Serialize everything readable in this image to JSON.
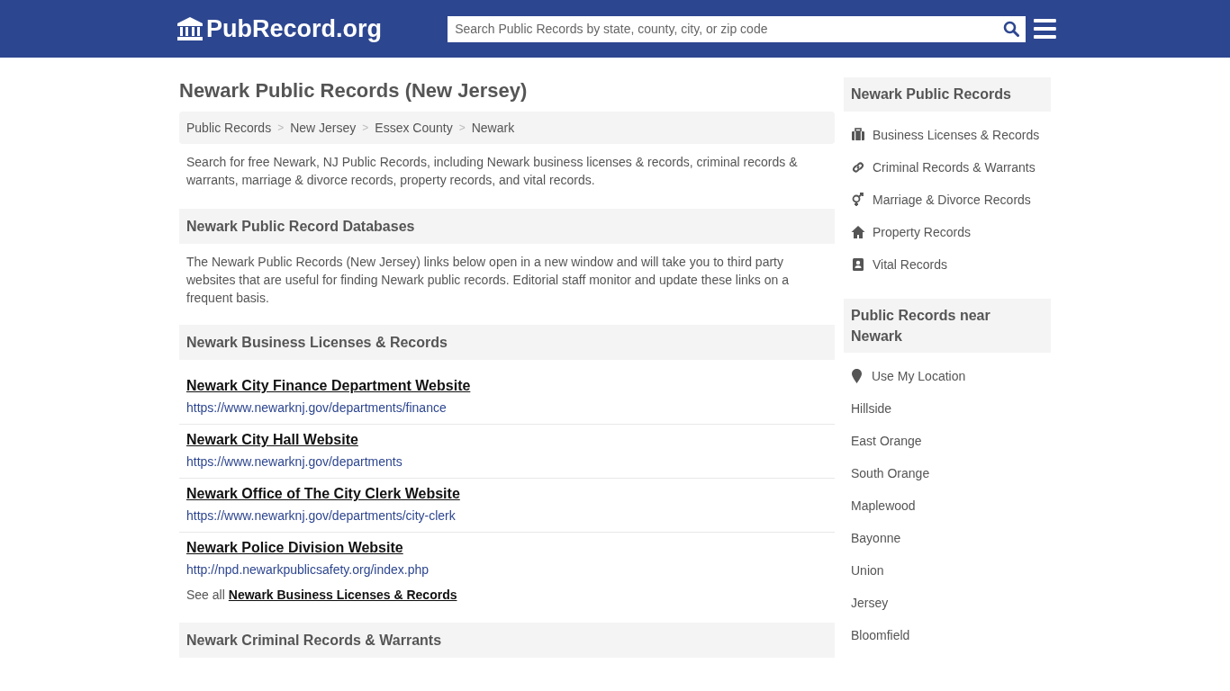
{
  "header": {
    "logo": "PubRecord.org",
    "search": {
      "placeholder": "Search Public Records by state, county, city, or zip code"
    }
  },
  "page_title": "Newark Public Records (New Jersey)",
  "breadcrumb": [
    {
      "label": "Public Records",
      "separator": ">"
    },
    {
      "label": "New Jersey",
      "separator": ">"
    },
    {
      "label": "Essex County",
      "separator": ">"
    },
    {
      "label": "Newark"
    }
  ],
  "intro": "Search for free Newark, NJ Public Records, including Newark business licenses & records, criminal records & warrants, marriage & divorce records, property records, and vital records.",
  "databases": {
    "heading": "Newark Public Record Databases",
    "text": "The Newark Public Records (New Jersey) links below open in a new window and will take you to third party websites that are useful for finding Newark public records. Editorial staff monitor and update these links on a frequent basis."
  },
  "sections": [
    {
      "heading": "Newark Business Licenses & Records",
      "links": [
        {
          "title": "Newark City Finance Department Website",
          "url": "https://www.newarknj.gov/departments/finance"
        },
        {
          "title": "Newark City Hall Website",
          "url": "https://www.newarknj.gov/departments"
        },
        {
          "title": "Newark Office of The City Clerk Website",
          "url": "https://www.newarknj.gov/departments/city-clerk"
        },
        {
          "title": "Newark Police Division Website",
          "url": "http://npd.newarkpublicsafety.org/index.php"
        }
      ],
      "see_all": {
        "prefix": "See all",
        "link": "Newark Business Licenses & Records"
      }
    },
    {
      "heading": "Newark Criminal Records & Warrants"
    }
  ],
  "sidebar": {
    "records": {
      "heading": "Newark Public Records",
      "items": [
        {
          "label": "Business Licenses & Records"
        },
        {
          "label": "Criminal Records & Warrants"
        },
        {
          "label": "Marriage & Divorce Records"
        },
        {
          "label": "Property Records"
        },
        {
          "label": "Vital Records"
        }
      ]
    },
    "nearby": {
      "heading": "Public Records near Newark",
      "items": [
        {
          "label": "Use My Location",
          "kind": "location"
        },
        {
          "label": "Hillside",
          "kind": "place"
        },
        {
          "label": "East Orange",
          "kind": "place"
        },
        {
          "label": "South Orange",
          "kind": "place"
        },
        {
          "label": "Maplewood",
          "kind": "place"
        },
        {
          "label": "Bayonne",
          "kind": "place"
        },
        {
          "label": "Union",
          "kind": "place"
        },
        {
          "label": "Jersey",
          "kind": "place"
        },
        {
          "label": "Bloomfield",
          "kind": "place"
        }
      ]
    }
  }
}
